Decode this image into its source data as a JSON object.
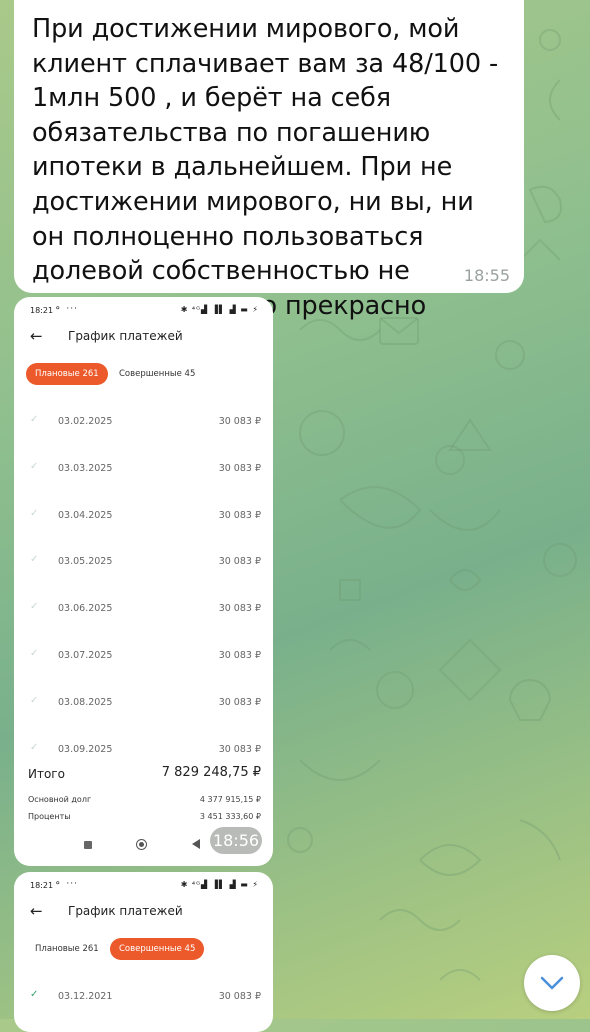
{
  "message": {
    "text": "При достижении мирового, мой клиент сплачивает вам за 48/100 - 1млн 500 , и берёт на себя обязательства по погашению ипотеки в дальнейшем. При не достижении мирового, ни вы, ни он полноценно пользоваться долевой собственностью не сможете, и вы это прекрасно понимаете",
    "time": "18:55"
  },
  "screenshot1": {
    "status_time": "18:21",
    "status_dots": "⚬ ···",
    "status_icons": "✱ ⁴ᴳ▟ ▐▌ ▟ ▬ ⚡",
    "title": "График платежей",
    "back_icon": "arrow-left-icon",
    "tabs": [
      {
        "label": "Плановые 261",
        "active": true
      },
      {
        "label": "Совершенные 45",
        "active": false
      }
    ],
    "rows": [
      {
        "date": "03.02.2025",
        "amount": "30 083 ₽"
      },
      {
        "date": "03.03.2025",
        "amount": "30 083 ₽"
      },
      {
        "date": "03.04.2025",
        "amount": "30 083 ₽"
      },
      {
        "date": "03.05.2025",
        "amount": "30 083 ₽"
      },
      {
        "date": "03.06.2025",
        "amount": "30 083 ₽"
      },
      {
        "date": "03.07.2025",
        "amount": "30 083 ₽"
      },
      {
        "date": "03.08.2025",
        "amount": "30 083 ₽"
      },
      {
        "date": "03.09.2025",
        "amount": "30 083 ₽"
      }
    ],
    "total_label": "Итого",
    "total_value": "7 829 248,75 ₽",
    "principal_label": "Основной долг",
    "principal_value": "4 377 915,15 ₽",
    "interest_label": "Проценты",
    "interest_value": "3 451 333,60 ₽",
    "time": "18:56"
  },
  "screenshot2": {
    "status_time": "18:21",
    "status_dots": "⚬ ···",
    "status_icons": "✱ ⁴ᴳ▟ ▐▌ ▟ ▬ ⚡",
    "title": "График платежей",
    "tabs": [
      {
        "label": "Плановые 261",
        "active": false
      },
      {
        "label": "Совершенные 45",
        "active": true
      }
    ],
    "rows": [
      {
        "date": "03.12.2021",
        "amount": "30 083 ₽"
      }
    ]
  },
  "colors": {
    "accent": "#ec5a2b",
    "check_done": "#3aa36b",
    "check_pending": "#c9d9cf"
  },
  "scroll_button_icon": "chevron-down-icon"
}
